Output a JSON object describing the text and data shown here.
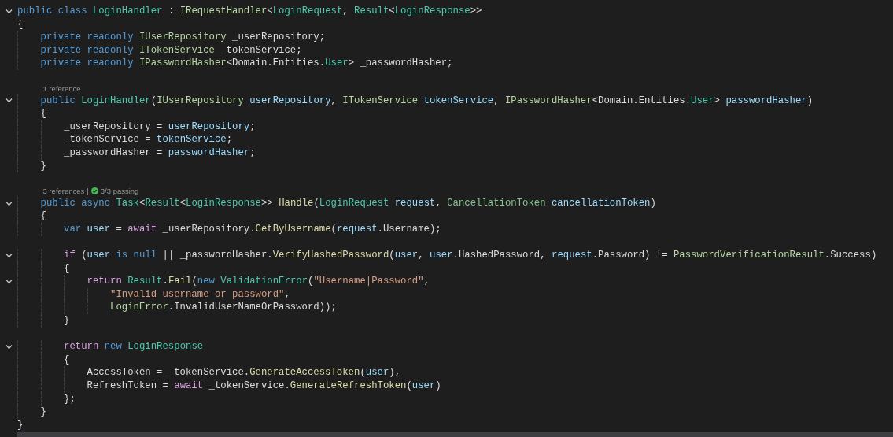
{
  "editor": {
    "lines": [
      {
        "kind": "code",
        "expanded": true,
        "tokens": [
          {
            "kind": "kw",
            "text": "public class "
          },
          {
            "kind": "cls",
            "text": "LoginHandler"
          },
          {
            "kind": "txt",
            "text": " : "
          },
          {
            "kind": "ifc",
            "text": "IRequestHandler"
          },
          {
            "kind": "txt",
            "text": "<"
          },
          {
            "kind": "cls",
            "text": "LoginRequest"
          },
          {
            "kind": "txt",
            "text": ", "
          },
          {
            "kind": "cls",
            "text": "Result"
          },
          {
            "kind": "txt",
            "text": "<"
          },
          {
            "kind": "cls",
            "text": "LoginResponse"
          },
          {
            "kind": "txt",
            "text": ">>"
          }
        ]
      },
      {
        "kind": "code",
        "tokens": [
          {
            "kind": "txt",
            "text": "{"
          }
        ]
      },
      {
        "kind": "code",
        "tokens": [
          {
            "kind": "kw",
            "text": "    private readonly "
          },
          {
            "kind": "ifc",
            "text": "IUserRepository"
          },
          {
            "kind": "txt",
            "text": " _userRepository;"
          }
        ]
      },
      {
        "kind": "code",
        "tokens": [
          {
            "kind": "kw",
            "text": "    private readonly "
          },
          {
            "kind": "ifc",
            "text": "ITokenService"
          },
          {
            "kind": "txt",
            "text": " _tokenService;"
          }
        ]
      },
      {
        "kind": "code",
        "tokens": [
          {
            "kind": "kw",
            "text": "    private readonly "
          },
          {
            "kind": "ifc",
            "text": "IPasswordHasher"
          },
          {
            "kind": "txt",
            "text": "<Domain.Entities."
          },
          {
            "kind": "cls",
            "text": "User"
          },
          {
            "kind": "txt",
            "text": "> _passwordHasher;"
          }
        ]
      },
      {
        "kind": "blank"
      },
      {
        "kind": "codelens",
        "references": "    1 reference"
      },
      {
        "kind": "code",
        "expanded": true,
        "tokens": [
          {
            "kind": "kw",
            "text": "    public "
          },
          {
            "kind": "cls",
            "text": "LoginHandler"
          },
          {
            "kind": "txt",
            "text": "("
          },
          {
            "kind": "ifc",
            "text": "IUserRepository "
          },
          {
            "kind": "var",
            "text": "userRepository"
          },
          {
            "kind": "txt",
            "text": ", "
          },
          {
            "kind": "ifc",
            "text": "ITokenService "
          },
          {
            "kind": "var",
            "text": "tokenService"
          },
          {
            "kind": "txt",
            "text": ", "
          },
          {
            "kind": "ifc",
            "text": "IPasswordHasher"
          },
          {
            "kind": "txt",
            "text": "<Domain.Entities."
          },
          {
            "kind": "cls",
            "text": "User"
          },
          {
            "kind": "txt",
            "text": "> "
          },
          {
            "kind": "var",
            "text": "passwordHasher"
          },
          {
            "kind": "txt",
            "text": ")"
          }
        ]
      },
      {
        "kind": "code",
        "tokens": [
          {
            "kind": "txt",
            "text": "    {"
          }
        ]
      },
      {
        "kind": "code",
        "tokens": [
          {
            "kind": "txt",
            "text": "        _userRepository = "
          },
          {
            "kind": "var",
            "text": "userRepository"
          },
          {
            "kind": "txt",
            "text": ";"
          }
        ]
      },
      {
        "kind": "code",
        "tokens": [
          {
            "kind": "txt",
            "text": "        _tokenService = "
          },
          {
            "kind": "var",
            "text": "tokenService"
          },
          {
            "kind": "txt",
            "text": ";"
          }
        ]
      },
      {
        "kind": "code",
        "tokens": [
          {
            "kind": "txt",
            "text": "        _passwordHasher = "
          },
          {
            "kind": "var",
            "text": "passwordHasher"
          },
          {
            "kind": "txt",
            "text": ";"
          }
        ]
      },
      {
        "kind": "code",
        "tokens": [
          {
            "kind": "txt",
            "text": "    }"
          }
        ]
      },
      {
        "kind": "blank"
      },
      {
        "kind": "codelens",
        "references": "    3 references",
        "separator": "|",
        "tests": {
          "passed": true,
          "label": "3/3 passing"
        }
      },
      {
        "kind": "code",
        "expanded": true,
        "tokens": [
          {
            "kind": "kw",
            "text": "    public async "
          },
          {
            "kind": "cls",
            "text": "Task"
          },
          {
            "kind": "txt",
            "text": "<"
          },
          {
            "kind": "cls",
            "text": "Result"
          },
          {
            "kind": "txt",
            "text": "<"
          },
          {
            "kind": "cls",
            "text": "LoginResponse"
          },
          {
            "kind": "txt",
            "text": ">> "
          },
          {
            "kind": "mth",
            "text": "Handle"
          },
          {
            "kind": "txt",
            "text": "("
          },
          {
            "kind": "cls",
            "text": "LoginRequest "
          },
          {
            "kind": "var",
            "text": "request"
          },
          {
            "kind": "txt",
            "text": ", "
          },
          {
            "kind": "st",
            "text": "CancellationToken "
          },
          {
            "kind": "var",
            "text": "cancellationToken"
          },
          {
            "kind": "txt",
            "text": ")"
          }
        ]
      },
      {
        "kind": "code",
        "tokens": [
          {
            "kind": "txt",
            "text": "    {"
          }
        ]
      },
      {
        "kind": "code",
        "tokens": [
          {
            "kind": "kw",
            "text": "        var "
          },
          {
            "kind": "var",
            "text": "user"
          },
          {
            "kind": "txt",
            "text": " = "
          },
          {
            "kind": "ctl",
            "text": "await "
          },
          {
            "kind": "txt",
            "text": "_userRepository."
          },
          {
            "kind": "mth",
            "text": "GetByUsername"
          },
          {
            "kind": "txt",
            "text": "("
          },
          {
            "kind": "var",
            "text": "request"
          },
          {
            "kind": "txt",
            "text": ".Username);"
          }
        ]
      },
      {
        "kind": "blank"
      },
      {
        "kind": "code",
        "expanded": true,
        "tokens": [
          {
            "kind": "ctl",
            "text": "        if "
          },
          {
            "kind": "txt",
            "text": "("
          },
          {
            "kind": "var",
            "text": "user "
          },
          {
            "kind": "kw",
            "text": "is null "
          },
          {
            "kind": "txt",
            "text": "|| _passwordHasher."
          },
          {
            "kind": "mth",
            "text": "VerifyHashedPassword"
          },
          {
            "kind": "txt",
            "text": "("
          },
          {
            "kind": "var",
            "text": "user"
          },
          {
            "kind": "txt",
            "text": ", "
          },
          {
            "kind": "var",
            "text": "user"
          },
          {
            "kind": "txt",
            "text": ".HashedPassword, "
          },
          {
            "kind": "var",
            "text": "request"
          },
          {
            "kind": "txt",
            "text": ".Password) != "
          },
          {
            "kind": "ifc",
            "text": "PasswordVerificationResult"
          },
          {
            "kind": "txt",
            "text": ".Success)"
          }
        ]
      },
      {
        "kind": "code",
        "tokens": [
          {
            "kind": "txt",
            "text": "        {"
          }
        ]
      },
      {
        "kind": "code",
        "expanded": true,
        "tokens": [
          {
            "kind": "ctl",
            "text": "            return "
          },
          {
            "kind": "cls",
            "text": "Result"
          },
          {
            "kind": "txt",
            "text": "."
          },
          {
            "kind": "mth",
            "text": "Fail"
          },
          {
            "kind": "txt",
            "text": "("
          },
          {
            "kind": "kw",
            "text": "new "
          },
          {
            "kind": "cls",
            "text": "ValidationError"
          },
          {
            "kind": "txt",
            "text": "("
          },
          {
            "kind": "str",
            "text": "\"Username|Password\""
          },
          {
            "kind": "txt",
            "text": ","
          }
        ]
      },
      {
        "kind": "code",
        "tokens": [
          {
            "kind": "str",
            "text": "                \"Invalid username or password\""
          },
          {
            "kind": "txt",
            "text": ","
          }
        ]
      },
      {
        "kind": "code",
        "tokens": [
          {
            "kind": "ifc",
            "text": "                LoginError"
          },
          {
            "kind": "txt",
            "text": ".InvalidUserNameOrPassword));"
          }
        ]
      },
      {
        "kind": "code",
        "tokens": [
          {
            "kind": "txt",
            "text": "        }"
          }
        ]
      },
      {
        "kind": "blank"
      },
      {
        "kind": "code",
        "expanded": true,
        "tokens": [
          {
            "kind": "ctl",
            "text": "        return "
          },
          {
            "kind": "kw",
            "text": "new "
          },
          {
            "kind": "cls",
            "text": "LoginResponse"
          }
        ]
      },
      {
        "kind": "code",
        "tokens": [
          {
            "kind": "txt",
            "text": "        {"
          }
        ]
      },
      {
        "kind": "code",
        "tokens": [
          {
            "kind": "txt",
            "text": "            AccessToken = _tokenService."
          },
          {
            "kind": "mth",
            "text": "GenerateAccessToken"
          },
          {
            "kind": "txt",
            "text": "("
          },
          {
            "kind": "var",
            "text": "user"
          },
          {
            "kind": "txt",
            "text": "),"
          }
        ]
      },
      {
        "kind": "code",
        "tokens": [
          {
            "kind": "txt",
            "text": "            RefreshToken = "
          },
          {
            "kind": "ctl",
            "text": "await "
          },
          {
            "kind": "txt",
            "text": "_tokenService."
          },
          {
            "kind": "mth",
            "text": "GenerateRefreshToken"
          },
          {
            "kind": "txt",
            "text": "("
          },
          {
            "kind": "var",
            "text": "user"
          },
          {
            "kind": "txt",
            "text": ")"
          }
        ]
      },
      {
        "kind": "code",
        "tokens": [
          {
            "kind": "txt",
            "text": "        };"
          }
        ]
      },
      {
        "kind": "code",
        "tokens": [
          {
            "kind": "txt",
            "text": "    }"
          }
        ]
      },
      {
        "kind": "code",
        "tokens": [
          {
            "kind": "txt",
            "text": "}"
          }
        ]
      }
    ]
  }
}
